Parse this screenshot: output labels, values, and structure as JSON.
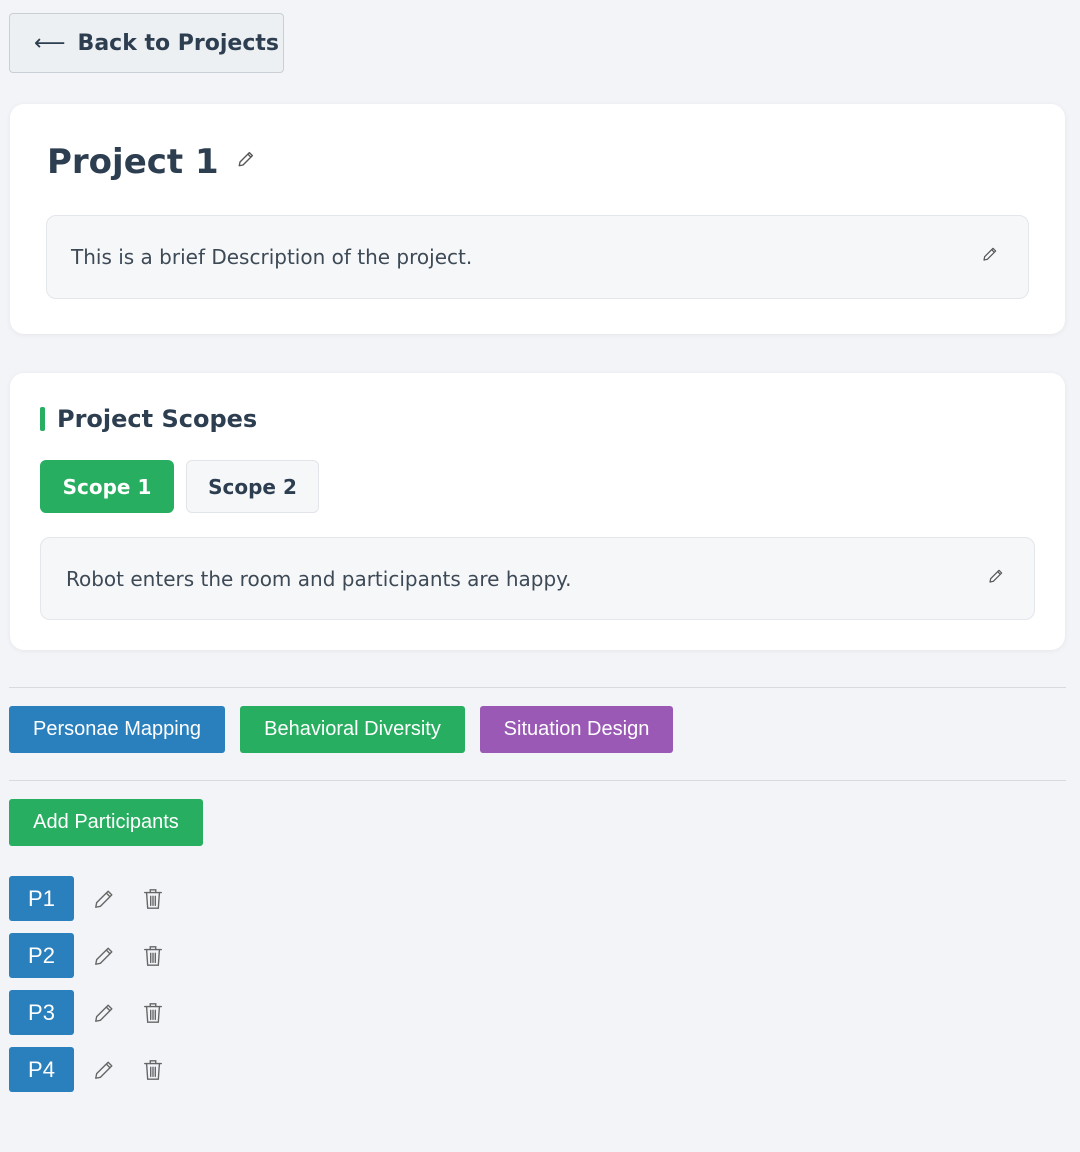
{
  "nav": {
    "back_arrow": "⟵",
    "back_label": "Back to Projects"
  },
  "project": {
    "title": "Project 1",
    "description": "This is a brief Description of the project."
  },
  "scopes": {
    "heading": "Project Scopes",
    "tabs": [
      {
        "label": "Scope 1",
        "active": true
      },
      {
        "label": "Scope 2",
        "active": false
      }
    ],
    "active_description": "Robot enters the room and participants are happy."
  },
  "modules": [
    {
      "label": "Personae Mapping",
      "color": "#2a7fbd"
    },
    {
      "label": "Behavioral Diversity",
      "color": "#27ae60"
    },
    {
      "label": "Situation Design",
      "color": "#9b59b6"
    }
  ],
  "participants": {
    "add_label": "Add Participants",
    "items": [
      {
        "label": "P1"
      },
      {
        "label": "P2"
      },
      {
        "label": "P3"
      },
      {
        "label": "P4"
      }
    ]
  },
  "colors": {
    "accent_green": "#27ae60",
    "accent_blue": "#2a7fbd",
    "accent_purple": "#9b59b6",
    "background": "#f3f4f8"
  },
  "icons": {
    "edit": "pencil-icon",
    "delete": "trash-icon"
  }
}
